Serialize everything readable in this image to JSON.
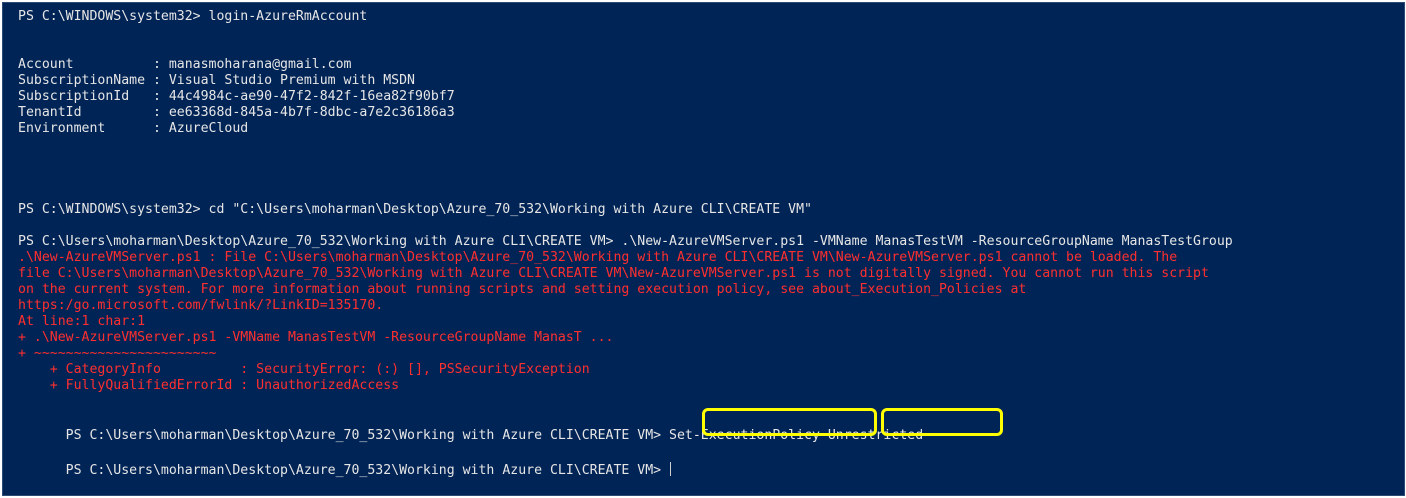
{
  "colors": {
    "background": "#012456",
    "text": "#e6e6e6",
    "error": "#ff2f2f",
    "highlight": "#ffff00"
  },
  "console": {
    "lines": [
      "PS C:\\WINDOWS\\system32> login-AzureRmAccount",
      "Account          : manasmoharana@gmail.com",
      "SubscriptionName : Visual Studio Premium with MSDN",
      "SubscriptionId   : 44c4984c-ae90-47f2-842f-16ea82f90bf7",
      "TenantId         : ee63368d-845a-4b7f-8dbc-a7e2c36186a3",
      "Environment      : AzureCloud",
      "PS C:\\WINDOWS\\system32> cd \"C:\\Users\\moharman\\Desktop\\Azure_70_532\\Working with Azure CLI\\CREATE VM\"",
      "PS C:\\Users\\moharman\\Desktop\\Azure_70_532\\Working with Azure CLI\\CREATE VM> .\\New-AzureVMServer.ps1 -VMName ManasTestVM -ResourceGroupName ManasTestGroup",
      ".\\New-AzureVMServer.ps1 : File C:\\Users\\moharman\\Desktop\\Azure_70_532\\Working with Azure CLI\\CREATE VM\\New-AzureVMServer.ps1 cannot be loaded. The",
      "file C:\\Users\\moharman\\Desktop\\Azure_70_532\\Working with Azure CLI\\CREATE VM\\New-AzureVMServer.ps1 is not digitally signed. You cannot run this script",
      "on the current system. For more information about running scripts and setting execution policy, see about_Execution_Policies at",
      "https:/go.microsoft.com/fwlink/?LinkID=135170.",
      "At line:1 char:1",
      "+ .\\New-AzureVMServer.ps1 -VMName ManasTestVM -ResourceGroupName ManasT ...",
      "+ ~~~~~~~~~~~~~~~~~~~~~~~",
      "    + CategoryInfo          : SecurityError: (:) [], PSSecurityException",
      "    + FullyQualifiedErrorId : UnauthorizedAccess"
    ],
    "policy_line": {
      "prompt": "PS C:\\Users\\moharman\\Desktop\\Azure_70_532\\Working with Azure CLI\\CREATE VM> ",
      "command": "Set-ExecutionPolicy",
      "separator": " ",
      "argument": "Unrestricted"
    },
    "current_prompt": "PS C:\\Users\\moharman\\Desktop\\Azure_70_532\\Working with Azure CLI\\CREATE VM> "
  }
}
